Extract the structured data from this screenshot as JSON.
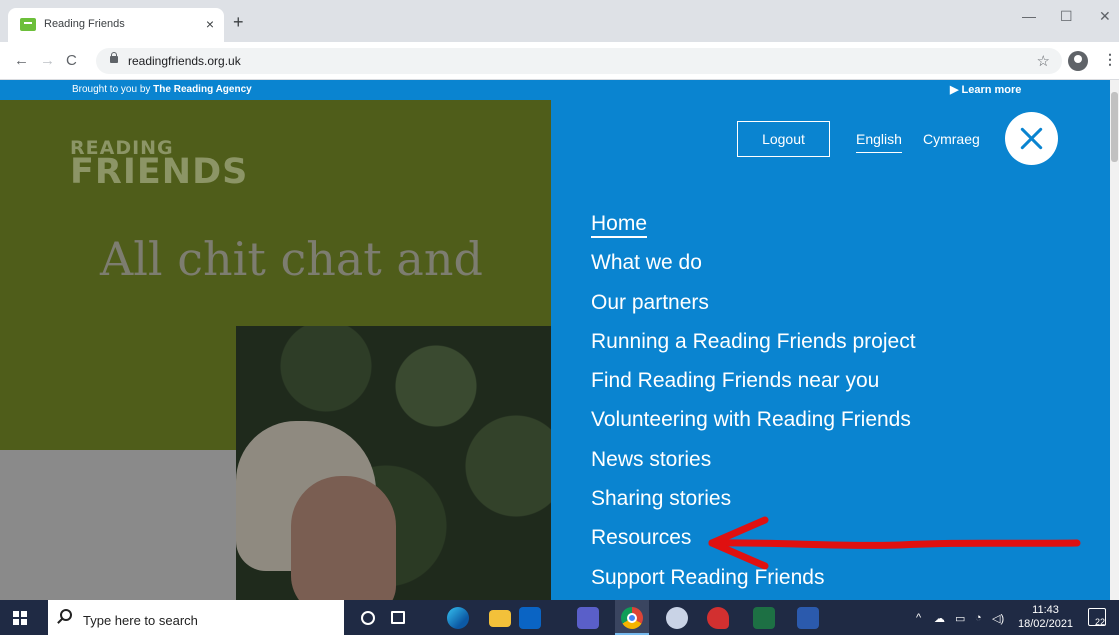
{
  "browser": {
    "tab_title": "Reading Friends",
    "tab_close": "×",
    "new_tab": "+",
    "window_controls": {
      "minimize": "—",
      "maximize": "☐",
      "close": "✕"
    },
    "back": "←",
    "forward": "→",
    "reload": "C",
    "url": "readingfriends.org.uk",
    "bookmark": "☆",
    "menu": "⋮"
  },
  "site": {
    "topbar": {
      "brought_prefix": "Brought to you by ",
      "brought_org": "The Reading Agency",
      "learn_more": "▶ Learn more"
    },
    "logo": {
      "line1": "READING",
      "line2": "FRIENDS"
    },
    "hero_text": "All chit chat and",
    "menu": {
      "logout": "Logout",
      "lang_english": "English",
      "lang_welsh": "Cymraeg",
      "items": [
        {
          "label": "Home"
        },
        {
          "label": "What we do"
        },
        {
          "label": "Our partners"
        },
        {
          "label": "Running a Reading Friends project"
        },
        {
          "label": "Find Reading Friends near you"
        },
        {
          "label": "Volunteering with Reading Friends"
        },
        {
          "label": "News stories"
        },
        {
          "label": "Sharing stories"
        },
        {
          "label": "Resources"
        },
        {
          "label": "Support Reading Friends"
        }
      ],
      "active_item": "Home",
      "highlighted_item": "Resources"
    },
    "annotation": {
      "color": "#e01010",
      "points_to": "Resources"
    }
  },
  "taskbar": {
    "search_placeholder": "Type here to search",
    "apps": [
      "cortana-icon",
      "task-view-icon",
      "edge-icon",
      "file-explorer-icon",
      "outlook-icon",
      "teams-icon",
      "chrome-icon",
      "snipping-tool-icon",
      "paint-3d-icon",
      "excel-icon",
      "word-icon"
    ],
    "time": "11:43",
    "date": "18/02/2021",
    "notifications": "22"
  },
  "colors": {
    "menu_blue": "#0a84d0",
    "hero_green": "#4f5d1a",
    "taskbar": "#1f2a44"
  }
}
